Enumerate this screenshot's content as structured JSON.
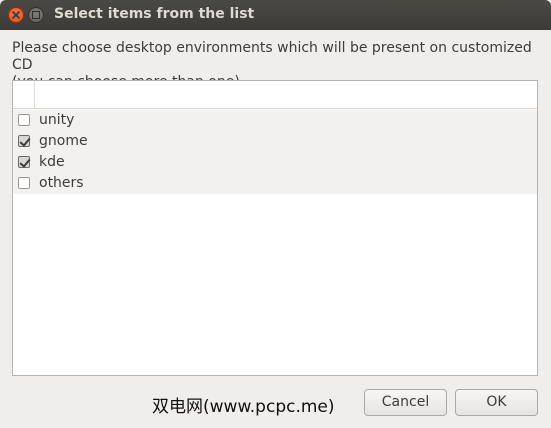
{
  "window": {
    "title": "Select items from the list"
  },
  "prompt": {
    "line1": "Please choose desktop environments which will be present on customized CD",
    "line2": "(you can choose more than one)"
  },
  "list": {
    "items": [
      {
        "label": "unity",
        "checked": false
      },
      {
        "label": "gnome",
        "checked": true
      },
      {
        "label": "kde",
        "checked": true
      },
      {
        "label": "others",
        "checked": false
      }
    ]
  },
  "watermark": {
    "text": "双电网(www.pcpc.me)"
  },
  "buttons": {
    "cancel_label": "Cancel",
    "ok_label": "OK"
  },
  "colors": {
    "titlebar": "#3c3b37",
    "close_button": "#df4a16",
    "window_bg": "#efeeec"
  }
}
